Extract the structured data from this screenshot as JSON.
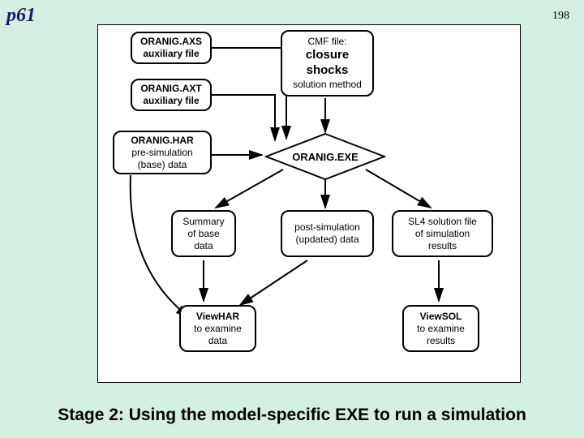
{
  "page": {
    "label": "p61",
    "number": "198"
  },
  "caption": "Stage 2: Using the model-specific EXE to run a simulation",
  "boxes": {
    "axs": {
      "l1": "ORANIG.AXS",
      "l2": "auxiliary file"
    },
    "axt": {
      "l1": "ORANIG.AXT",
      "l2": "auxiliary file"
    },
    "har": {
      "l1": "ORANIG.HAR",
      "l2": "pre-simulation",
      "l3": "(base) data"
    },
    "cmf": {
      "l1": "CMF file:",
      "l2": "closure",
      "l3": "shocks",
      "l4": "solution method"
    },
    "exe": {
      "label": "ORANIG.EXE"
    },
    "sum": {
      "l1": "Summary",
      "l2": "of base",
      "l3": "data"
    },
    "post": {
      "l1": "post-simulation",
      "l2": "(updated) data"
    },
    "sl4": {
      "l1": "SL4 solution file",
      "l2": "of simulation",
      "l3": "results"
    },
    "vhar": {
      "l1": "ViewHAR",
      "l2": "to examine",
      "l3": "data"
    },
    "vsol": {
      "l1": "ViewSOL",
      "l2": "to examine",
      "l3": "results"
    }
  }
}
